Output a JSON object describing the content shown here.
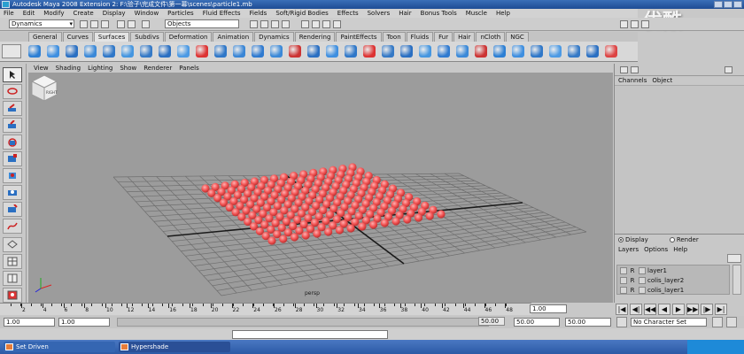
{
  "window": {
    "title": "Autodesk Maya 2008 Extension 2: F:\\验子\\完成文件\\第一幕\\scenes\\particle1.mb"
  },
  "watermark": {
    "text": "优酷",
    "sub": "YOUKU"
  },
  "menubar": {
    "items": [
      "File",
      "Edit",
      "Modify",
      "Create",
      "Display",
      "Window",
      "Particles",
      "Fluid Effects",
      "Fields",
      "Soft/Rigid Bodies",
      "Effects",
      "Solvers",
      "Hair",
      "Bonus Tools",
      "Muscle",
      "Help"
    ]
  },
  "statusline": {
    "mode": "Dynamics",
    "selection_field": "Objects"
  },
  "shelf": {
    "tabs": [
      "General",
      "Curves",
      "Surfaces",
      "Subdivs",
      "Deformation",
      "Animation",
      "Dynamics",
      "Rendering",
      "PaintEffects",
      "Toon",
      "Fluids",
      "Fur",
      "Hair",
      "nCloth",
      "NGC"
    ],
    "active_tab": "Surfaces",
    "icon_colors": [
      "#2c7fd4",
      "#3f8fe0",
      "#2a6fc2",
      "#3b89d8",
      "#2f77c8",
      "#4596e0",
      "#3579c6",
      "#2a6fc2",
      "#4c9ae4",
      "#d33",
      "#2f77c8",
      "#3a86d6",
      "#2f7ad0",
      "#3b89d8",
      "#c33",
      "#2a6fc2",
      "#3f8fe0",
      "#2f77c8",
      "#d33",
      "#3579c6",
      "#2a6fc2",
      "#4596e0",
      "#2f7ad0",
      "#3b89d8",
      "#c33",
      "#2c7fd4",
      "#3f8fe0",
      "#2f77c8",
      "#4c9ae4",
      "#3579c6",
      "#2a6fc2",
      "#d44"
    ]
  },
  "viewport": {
    "menu": [
      "View",
      "Shading",
      "Lighting",
      "Show",
      "Renderer",
      "Panels"
    ],
    "camera_label": "persp",
    "viewcube_label": "RIGHT",
    "particle_grid": {
      "rows": 12,
      "cols": 16,
      "color": "#f05050"
    },
    "grid_color": "#6e6e6e",
    "axis_color": "#1a1a1a"
  },
  "channelbox": {
    "menu": [
      "Channels",
      "Object"
    ]
  },
  "layer_editor": {
    "radio_display": "Display",
    "radio_render": "Render",
    "menu": [
      "Layers",
      "Options",
      "Help"
    ],
    "layers": [
      {
        "flag": "R",
        "name": "layer1"
      },
      {
        "flag": "R",
        "name": "colis_layer2"
      },
      {
        "flag": "R",
        "name": "colis_layer1"
      }
    ]
  },
  "timeslider": {
    "ticks": [
      "2",
      "4",
      "6",
      "8",
      "10",
      "12",
      "14",
      "16",
      "18",
      "20",
      "22",
      "24",
      "26",
      "28",
      "30",
      "32",
      "34",
      "36",
      "38",
      "40",
      "42",
      "44",
      "46",
      "48"
    ],
    "current_frame": "1.00"
  },
  "playback": {
    "buttons": [
      "|◀",
      "◀|",
      "◀◀",
      "◀",
      "▶",
      "▶▶",
      "|▶",
      "▶|"
    ]
  },
  "rangeslider": {
    "start": "1.00",
    "playback_start": "1.00",
    "thumb": "50.00",
    "playback_end": "50.00",
    "end": "50.00",
    "character_set": "No Character Set"
  },
  "taskbar": {
    "tasks": [
      "Set Driven",
      "Hypershade"
    ]
  }
}
